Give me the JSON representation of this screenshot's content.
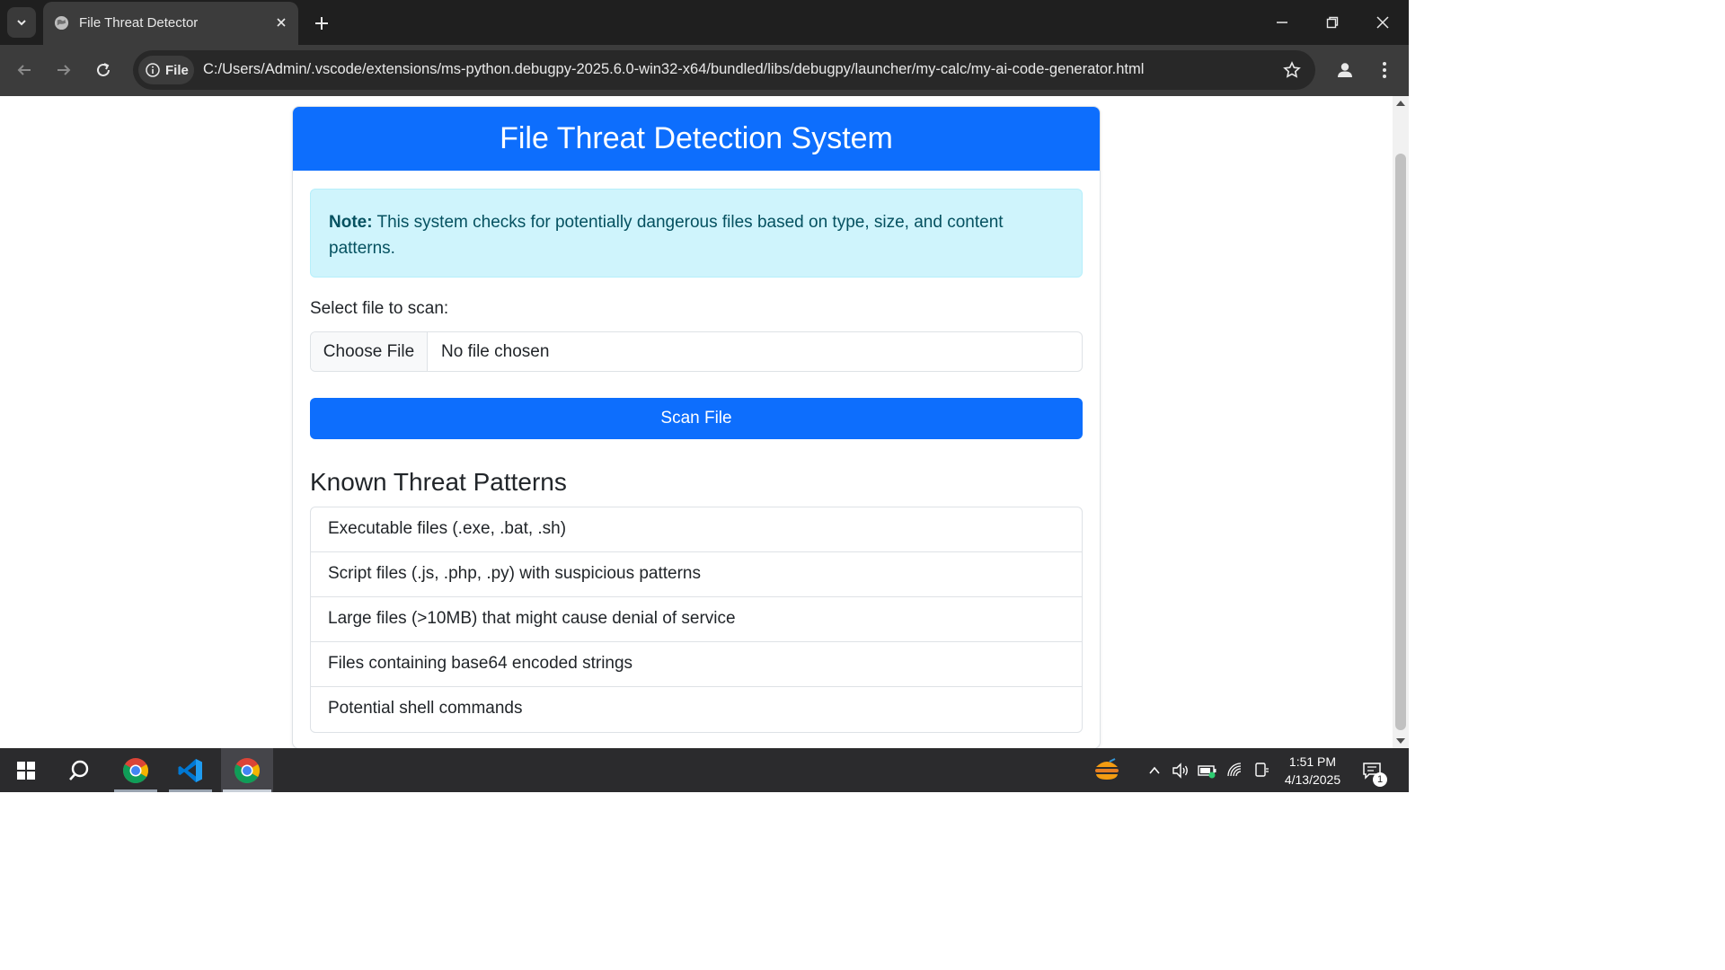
{
  "browser": {
    "tab": {
      "title": "File Threat Detector"
    },
    "address_bar": {
      "chip_label": "File",
      "url": "C:/Users/Admin/.vscode/extensions/ms-python.debugpy-2025.6.0-win32-x64/bundled/libs/debugpy/launcher/my-calc/my-ai-code-generator.html"
    }
  },
  "page": {
    "header_title": "File Threat Detection System",
    "note": {
      "label": "Note:",
      "text": " This system checks for potentially dangerous files based on type, size, and content patterns."
    },
    "file_field": {
      "label": "Select file to scan:",
      "button_label": "Choose File",
      "status": "No file chosen"
    },
    "scan_button": "Scan File",
    "threats_heading": "Known Threat Patterns",
    "threats": [
      "Executable files (.exe, .bat, .sh)",
      "Script files (.js, .php, .py) with suspicious patterns",
      "Large files (>10MB) that might cause denial of service",
      "Files containing base64 encoded strings",
      "Potential shell commands"
    ]
  },
  "taskbar": {
    "time": "1:51 PM",
    "date": "4/13/2025",
    "notification_count": "1"
  },
  "colors": {
    "primary": "#0d6efd",
    "alert_bg": "#cff4fc",
    "alert_text": "#055160"
  }
}
